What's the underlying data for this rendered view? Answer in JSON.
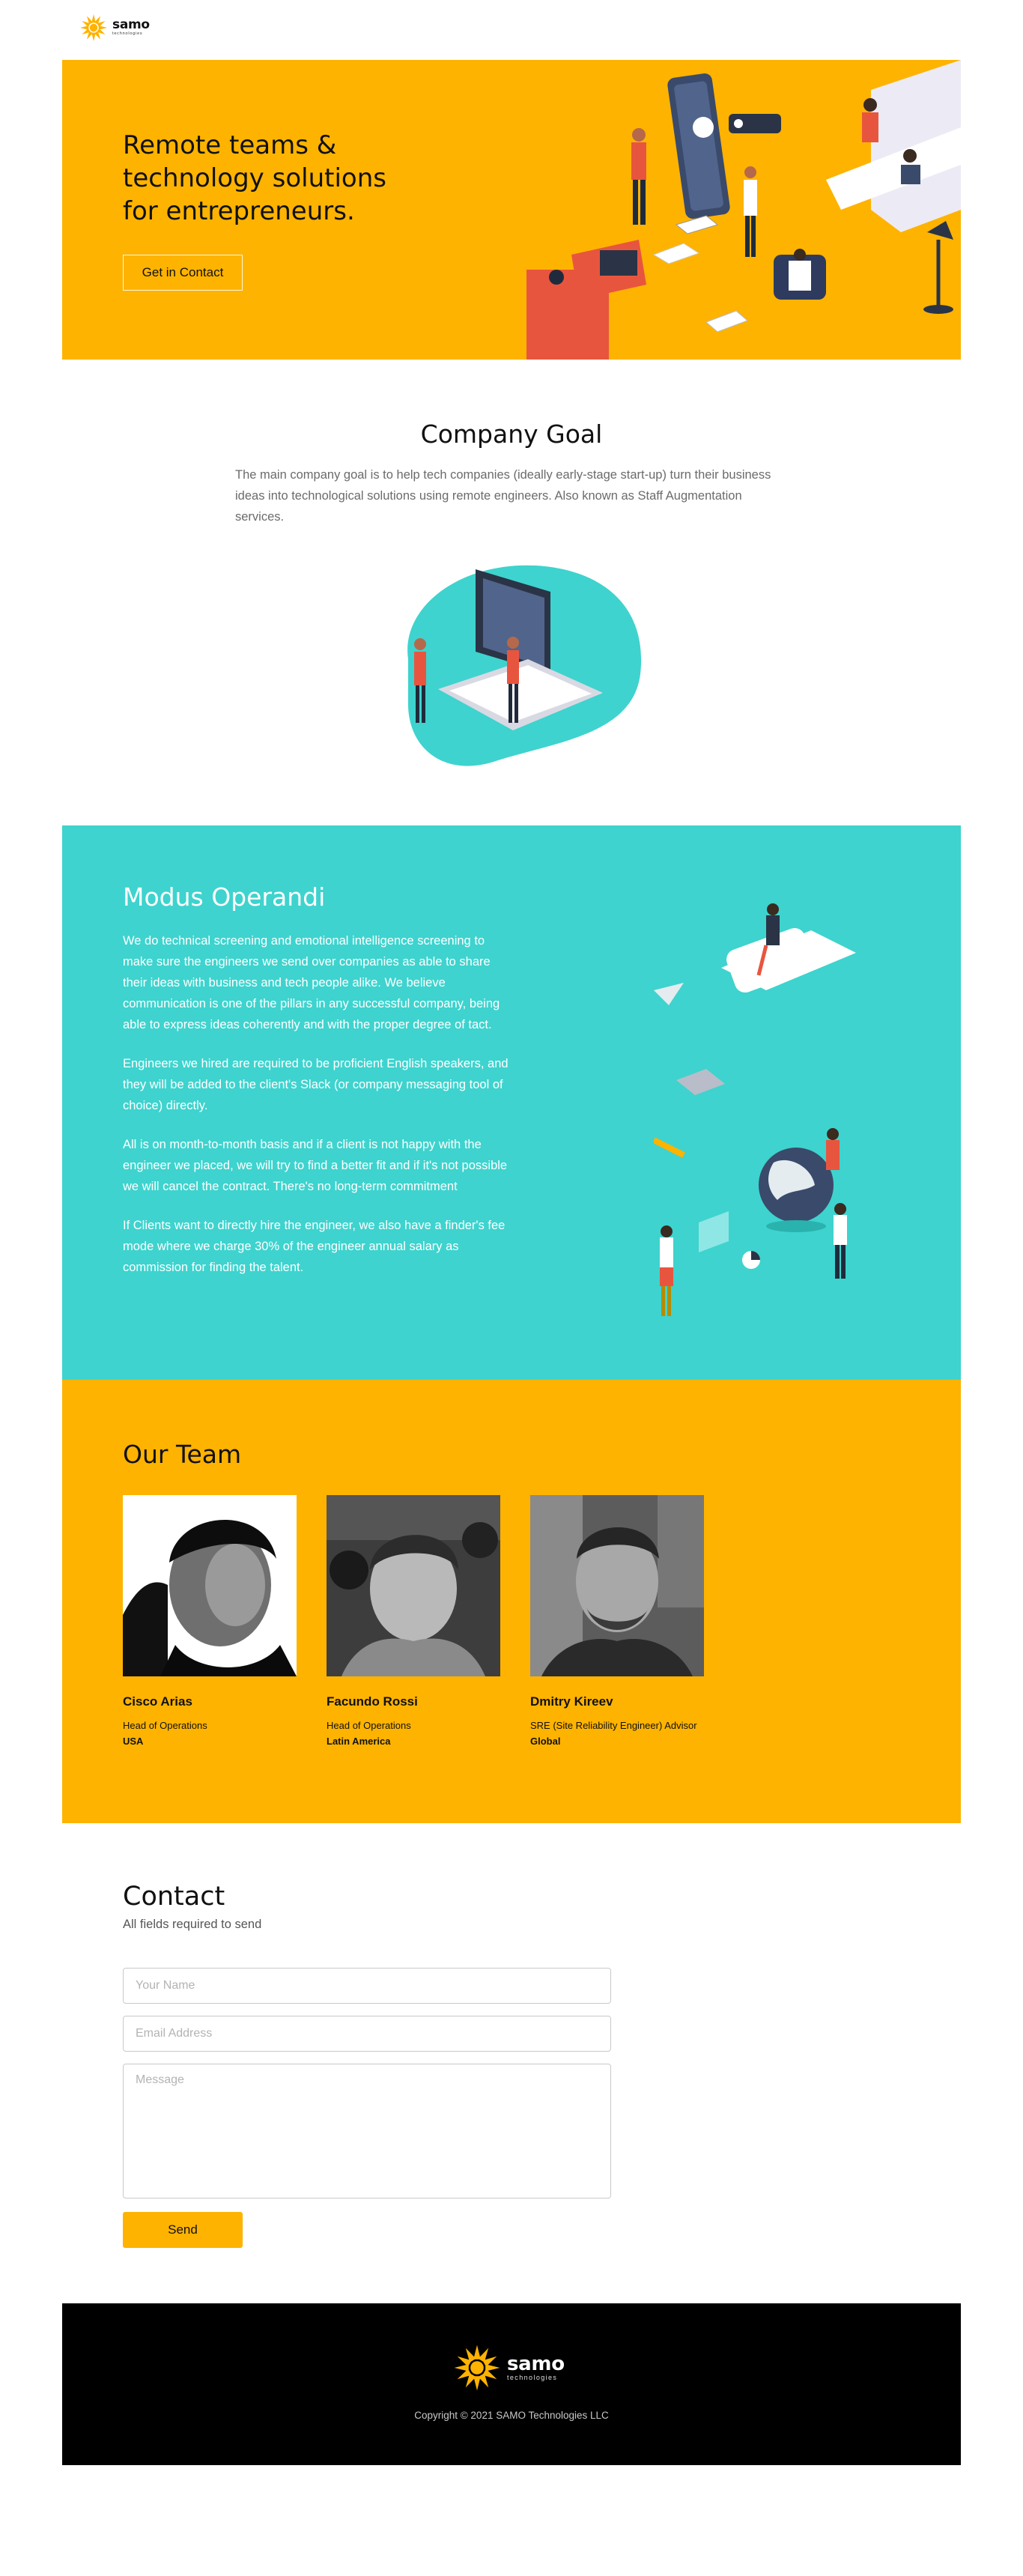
{
  "brand": {
    "name": "samo",
    "tagline": "technologies",
    "color": "#feb301"
  },
  "hero": {
    "title": "Remote teams & technology solutions for entrepreneurs.",
    "cta_label": "Get in Contact",
    "bg_color": "#feb301"
  },
  "goal": {
    "title": "Company Goal",
    "text": "The main company goal is to help tech companies (ideally early-stage start-up) turn their business ideas into technological solutions using remote engineers. Also known as Staff Augmentation services."
  },
  "modus": {
    "title": "Modus Operandi",
    "bg_color": "#3ed3ce",
    "paragraphs": [
      "We do technical screening and emotional intelligence screening to make sure the engineers we send over companies as able to share their ideas with business and tech people alike. We believe communication is one of the pillars in any successful company, being able to express ideas coherently and with the proper degree of tact.",
      "Engineers we hired are required to be proficient English speakers, and they will be added to the client's Slack (or company messaging tool of choice) directly.",
      "All is on month-to-month basis and if a client is not happy with the engineer we placed, we will try to find a better fit and if it's not possible we will cancel the contract. There's no long-term commitment",
      "If Clients want to directly hire the engineer, we also have a finder's fee mode where we charge 30% of the engineer annual salary as commission for finding the talent."
    ]
  },
  "team": {
    "title": "Our Team",
    "members": [
      {
        "name": "Cisco Arias",
        "role": "Head of Operations",
        "location": "USA"
      },
      {
        "name": "Facundo Rossi",
        "role": "Head of Operations",
        "location": "Latin America"
      },
      {
        "name": "Dmitry Kireev",
        "role": "SRE (Site Reliability Engineer) Advisor",
        "location": "Global"
      }
    ]
  },
  "contact": {
    "title": "Contact",
    "subtitle": "All fields required to send",
    "name_placeholder": "Your Name",
    "email_placeholder": "Email Address",
    "message_placeholder": "Message",
    "send_label": "Send"
  },
  "footer": {
    "copyright": "Copyright © 2021 SAMO Technologies LLC"
  }
}
